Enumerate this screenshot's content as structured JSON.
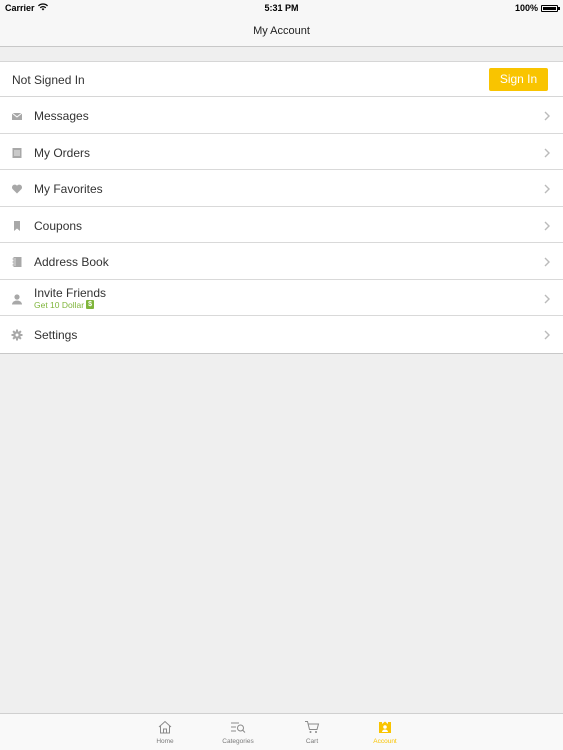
{
  "status_bar": {
    "carrier": "Carrier",
    "time": "5:31 PM",
    "battery": "100%"
  },
  "nav": {
    "title": "My Account"
  },
  "account": {
    "status": "Not Signed In",
    "sign_in_label": "Sign In"
  },
  "menu": {
    "items": [
      {
        "label": "Messages",
        "icon": "envelope-icon"
      },
      {
        "label": "My Orders",
        "icon": "orders-icon"
      },
      {
        "label": "My Favorites",
        "icon": "heart-icon"
      },
      {
        "label": "Coupons",
        "icon": "bookmark-icon"
      },
      {
        "label": "Address Book",
        "icon": "address-book-icon"
      },
      {
        "label": "Invite Friends",
        "sublabel": "Get 10 Dollar",
        "badge": "$",
        "icon": "person-icon"
      },
      {
        "label": "Settings",
        "icon": "gear-icon"
      }
    ]
  },
  "tabs": [
    {
      "label": "Home",
      "icon": "home-icon"
    },
    {
      "label": "Categories",
      "icon": "categories-icon"
    },
    {
      "label": "Cart",
      "icon": "cart-icon"
    },
    {
      "label": "Account",
      "icon": "account-icon",
      "active": true
    }
  ],
  "colors": {
    "accent": "#f9c400",
    "promo": "#7fb53b",
    "background": "#efefef"
  }
}
